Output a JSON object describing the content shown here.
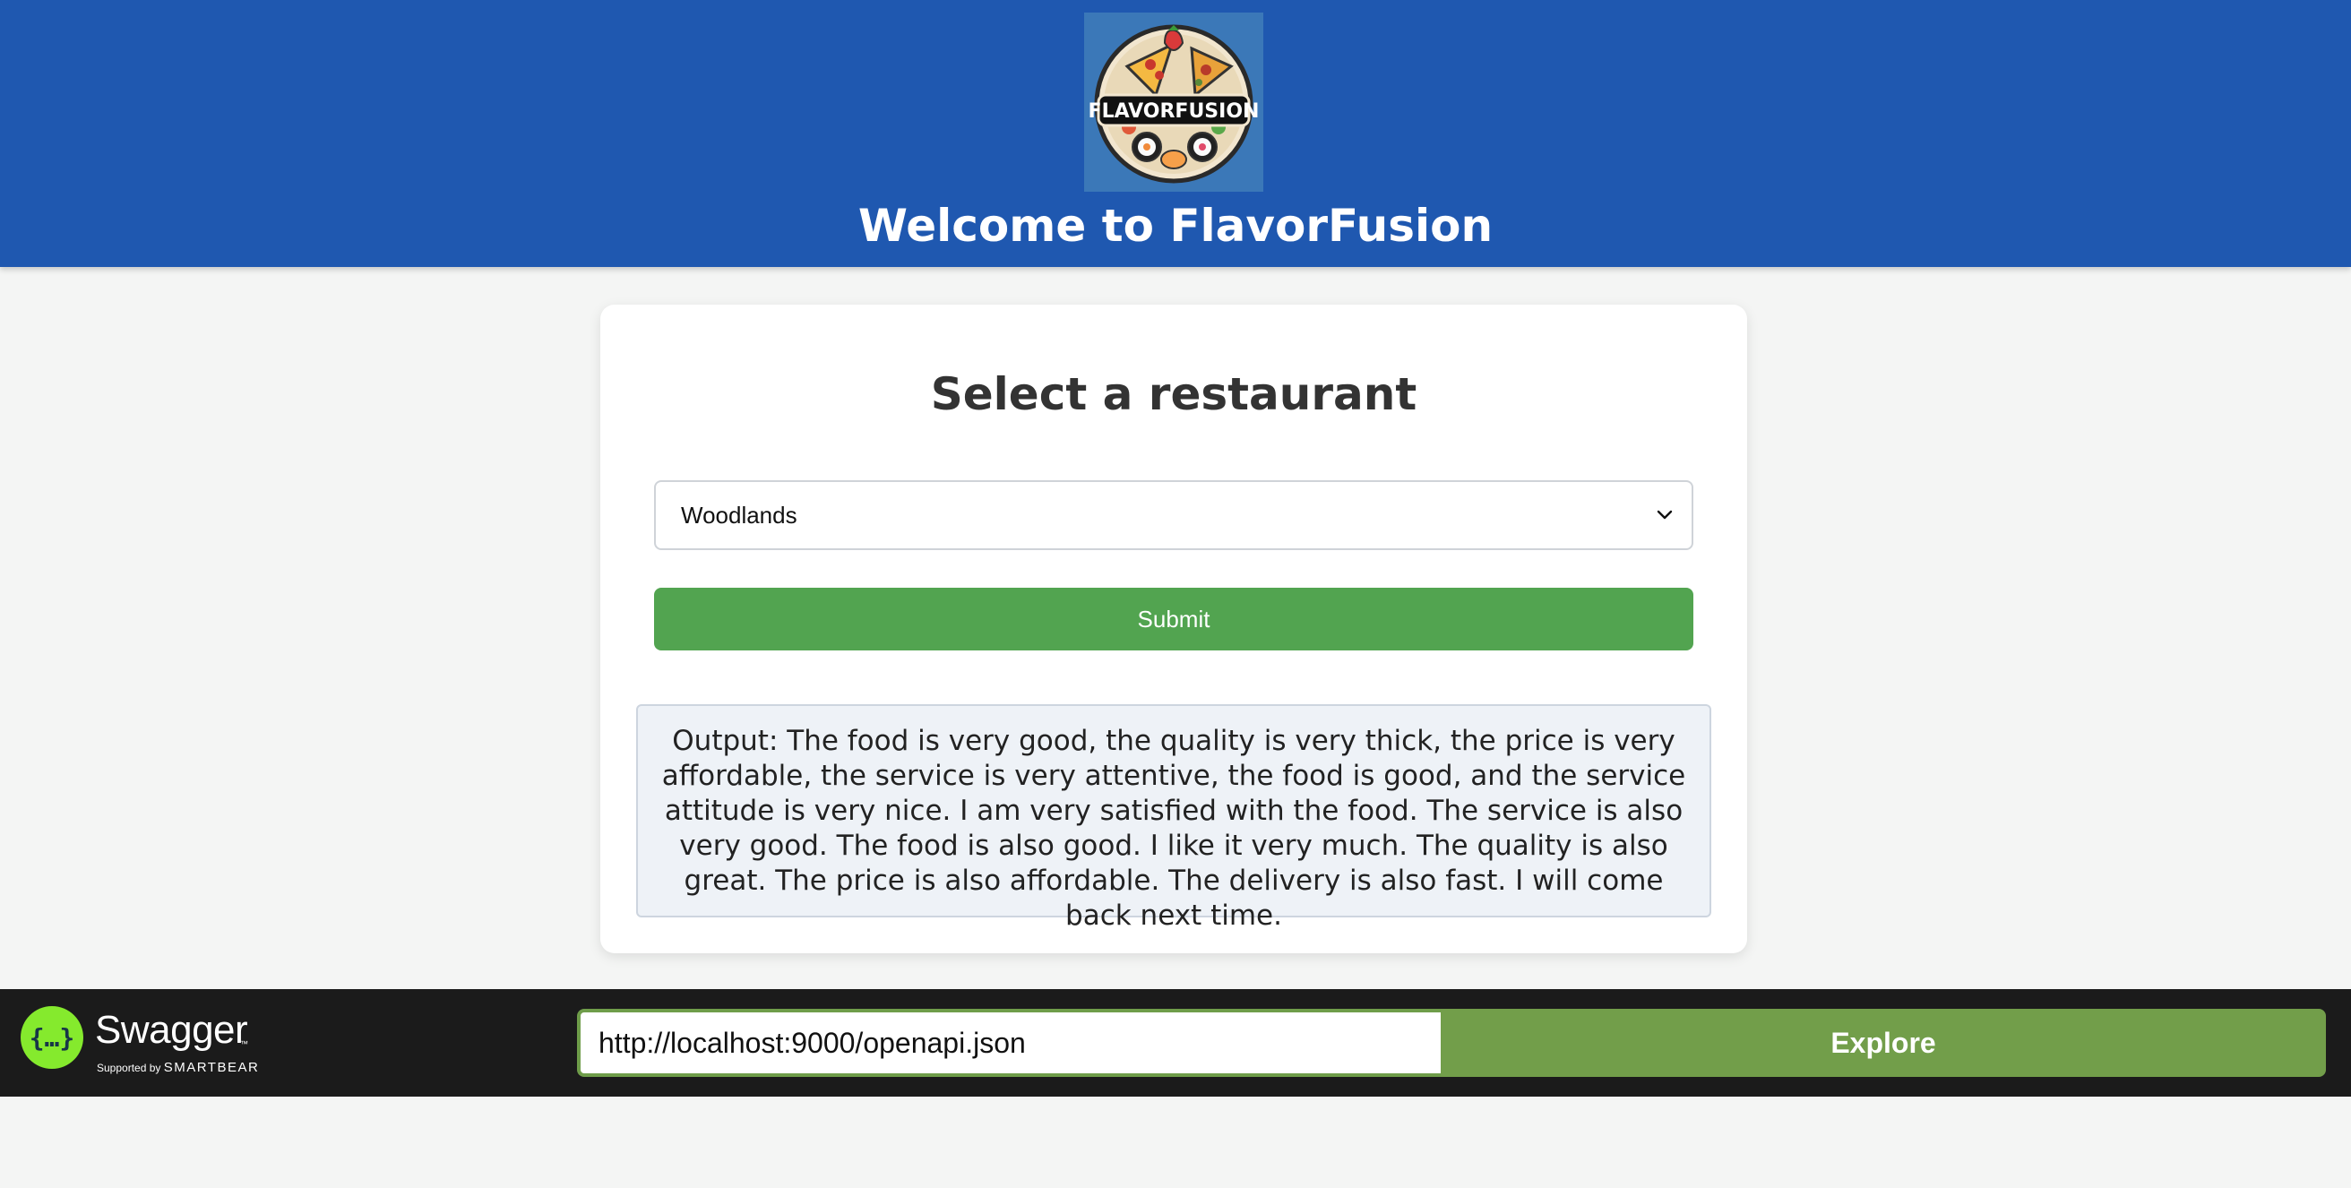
{
  "header": {
    "title": "Welcome to FlavorFusion",
    "logo_text": "FLAVORFUSION"
  },
  "form": {
    "heading": "Select a restaurant",
    "selected_restaurant": "Woodlands",
    "submit_label": "Submit",
    "output_text": "Output: The food is very good, the quality is very thick, the price is very affordable, the service is very attentive, the food is good, and the service attitude is very nice. I am very satisfied with the food. The service is also very good. The food is also good. I like it very much. The quality is also great. The price is also affordable. The delivery is also fast. I will come back next time."
  },
  "swagger": {
    "brand": "Swagger",
    "tm": "™",
    "supported_by": "Supported by",
    "smartbear": "SMARTBEAR",
    "url_value": "http://localhost:9000/openapi.json",
    "explore_label": "Explore"
  },
  "colors": {
    "header_bg": "#1f58b0",
    "submit_green": "#52a450",
    "explore_green": "#729e4a",
    "swagger_green": "#85ea2d",
    "footer_bg": "#1b1b1b"
  }
}
